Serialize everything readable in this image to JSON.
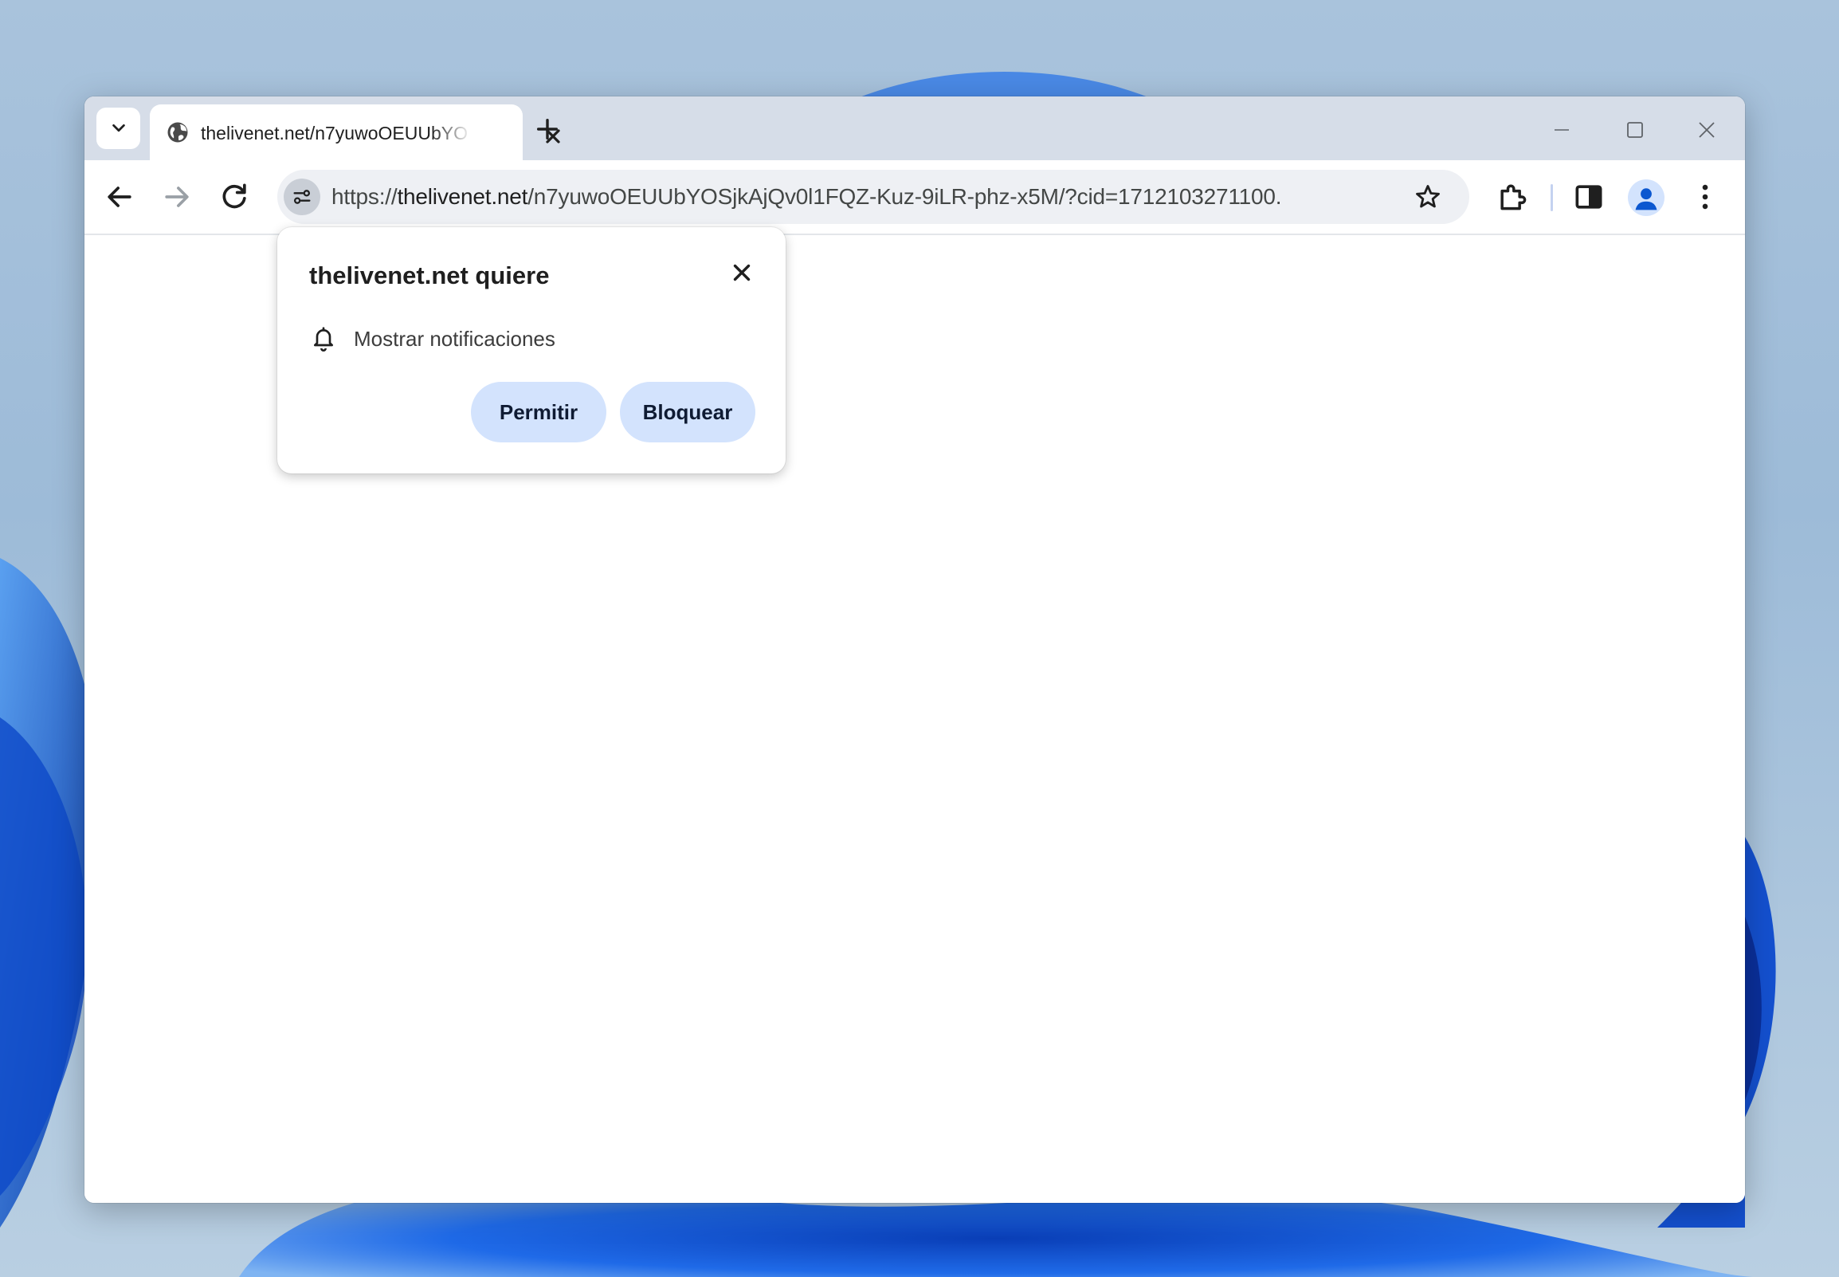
{
  "tab": {
    "title": "thelivenet.net/n7yuwoOEUUbYO"
  },
  "omnibox": {
    "url_scheme": "https://",
    "url_host": "thelivenet.net",
    "url_path": "/n7yuwoOEUUbYOSjkAjQv0l1FQZ-Kuz-9iLR-phz-x5M/?cid=1712103271100."
  },
  "permission_popup": {
    "title": "thelivenet.net quiere",
    "permission_label": "Mostrar notificaciones",
    "allow_label": "Permitir",
    "block_label": "Bloquear"
  },
  "colors": {
    "accent_button": "#d3e3fd",
    "titlebar": "#d6dde8",
    "omnibox": "#eef0f4"
  },
  "icons": [
    "tab-search-icon",
    "globe-icon",
    "close-icon",
    "plus-icon",
    "minimize-icon",
    "maximize-icon",
    "back-icon",
    "forward-icon",
    "reload-icon",
    "site-settings-icon",
    "star-icon",
    "extensions-icon",
    "side-panel-icon",
    "profile-icon",
    "more-vert-icon",
    "bell-icon"
  ]
}
